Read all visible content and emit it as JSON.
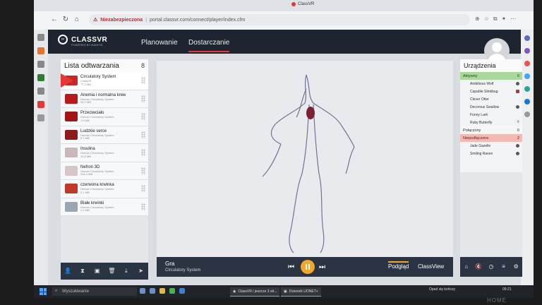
{
  "browser": {
    "tab_title": "ClassVR",
    "security_label": "Niezabezpieczona",
    "url": "portal.classvr.com/connect/player/index.cfm"
  },
  "app": {
    "logo_text": "CLASSVR",
    "logo_sub": "POWERED BY AVANTIS",
    "nav": [
      {
        "label": "Planowanie",
        "active": false
      },
      {
        "label": "Dostarczanie",
        "active": true
      }
    ]
  },
  "playlist": {
    "title": "Lista odtwarzania",
    "count": "8",
    "items": [
      {
        "name": "Circulatory System",
        "sub": "ClassVR",
        "size": "77.3 MB",
        "thumb_color": "#c62828"
      },
      {
        "name": "Anemia i normalna krew",
        "sub": "Human Circulatory System",
        "size": "35.2 MB",
        "thumb_color": "#b71c1c"
      },
      {
        "name": "Przeciwciało",
        "sub": "Human Circulatory System",
        "size": "1.8 MB",
        "thumb_color": "#a31515"
      },
      {
        "name": "Ludzkie serce",
        "sub": "Human Circulatory System",
        "size": "5.7 MB",
        "thumb_color": "#8e1b1b"
      },
      {
        "name": "Insulina",
        "sub": "Human Circulatory System",
        "size": "10.8 MB",
        "thumb_color": "#c9b8b8"
      },
      {
        "name": "Nefron 3D",
        "sub": "Human Circulatory System",
        "size": "316.4 MB",
        "thumb_color": "#d5c7c7"
      },
      {
        "name": "czerwona krwinka",
        "sub": "Human Circulatory System",
        "size": "2.1 MB",
        "thumb_color": "#c0392b"
      },
      {
        "name": "Białe krwinki",
        "sub": "Human Circulatory System",
        "size": "2.1 MB",
        "thumb_color": "#9aa6b2"
      }
    ]
  },
  "viewer": {
    "title": "Gra",
    "subtitle": "Circulatory System",
    "tabs": [
      {
        "label": "Podgląd",
        "active": true
      },
      {
        "label": "ClassView",
        "active": false
      }
    ]
  },
  "devices": {
    "title": "Urządzenia",
    "groups": [
      {
        "label": "Aktywny",
        "count": "6",
        "kind": "active",
        "devices": [
          "Ambitious Wolf",
          "Capable Stinkbug",
          "Clever Otter",
          "Decorous Swallow",
          "Funny Lark",
          "Ruby Butterfly"
        ]
      },
      {
        "label": "Połączony",
        "count": "0",
        "kind": "connected",
        "devices": []
      },
      {
        "label": "Niepodłączone",
        "count": "2",
        "kind": "unconnected",
        "devices": [
          "Jade Gazelle",
          "Smiling Raven"
        ]
      }
    ]
  },
  "taskbar": {
    "search_placeholder": "Wyszukiwanie",
    "apps": [
      "ClassVR i jeszcze 3 str...",
      "Dziennik UONET+"
    ],
    "weather": "Opad się kończy",
    "time": "09:21"
  },
  "bezel": {
    "label": "HOME"
  },
  "colors": {
    "accent": "#e53935",
    "header": "#1e2530",
    "toolbar": "#2b3442",
    "play": "#f2a62a",
    "active_group": "#a8d89a",
    "unconnected_group": "#f3b9b5"
  }
}
